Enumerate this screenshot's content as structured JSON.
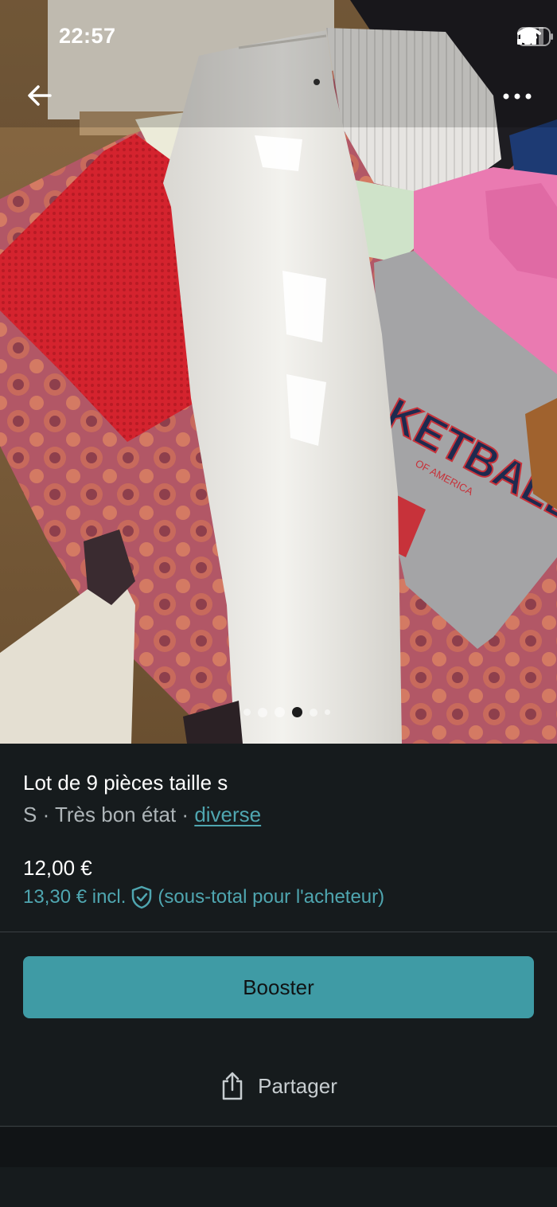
{
  "status_bar": {
    "time": "22:57"
  },
  "nav": {
    "back_icon": "arrow-left-icon",
    "more_icon": "more-horizontal-icon"
  },
  "carousel": {
    "total": 6,
    "active_index": 3
  },
  "item": {
    "title": "Lot de 9 pièces taille s",
    "meta_prefix": "S · Très bon état · ",
    "category_link": "diverse",
    "price": "12,00 €",
    "buyer_price": "13,30 € incl.",
    "buyer_note": "(sous-total pour l'acheteur)"
  },
  "actions": {
    "boost_label": "Booster",
    "share_label": "Partager"
  },
  "colors": {
    "accent": "#3f9ba5",
    "link": "#4fa6b0",
    "background": "#161b1d"
  }
}
